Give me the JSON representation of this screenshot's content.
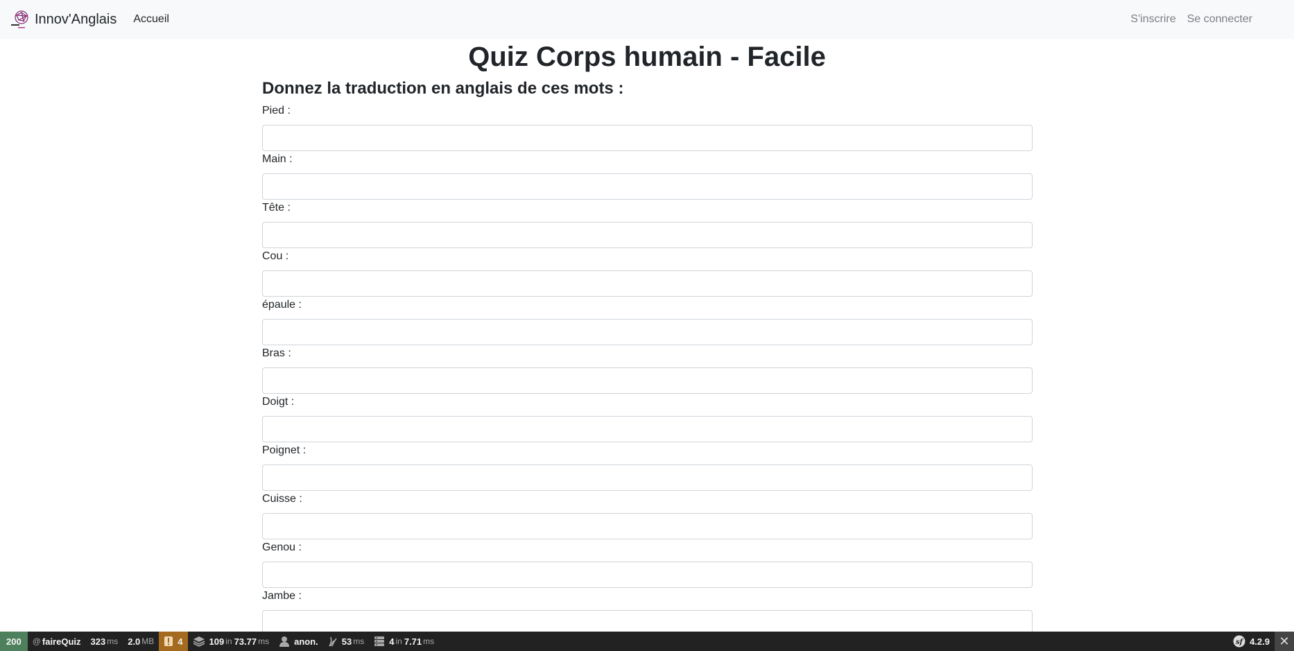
{
  "navbar": {
    "brand": "Innov'Anglais",
    "home": "Accueil",
    "signup": "S'inscrire",
    "login": "Se connecter"
  },
  "main": {
    "title": "Quiz Corps humain - Facile",
    "subtitle": "Donnez la traduction en anglais de ces mots :",
    "fields": [
      {
        "label": "Pied :",
        "value": ""
      },
      {
        "label": "Main :",
        "value": ""
      },
      {
        "label": "Tête :",
        "value": ""
      },
      {
        "label": "Cou :",
        "value": ""
      },
      {
        "label": "épaule :",
        "value": ""
      },
      {
        "label": "Bras :",
        "value": ""
      },
      {
        "label": "Doigt :",
        "value": ""
      },
      {
        "label": "Poignet :",
        "value": ""
      },
      {
        "label": "Cuisse :",
        "value": ""
      },
      {
        "label": "Genou :",
        "value": ""
      },
      {
        "label": "Jambe :",
        "value": ""
      }
    ]
  },
  "toolbar": {
    "status": "200",
    "route_prefix": "@",
    "route": "faireQuiz",
    "time_value": "323",
    "time_unit": "ms",
    "memory_value": "2.0",
    "memory_unit": "MB",
    "warnings": "4",
    "forms_value": "109",
    "forms_in": "in",
    "forms_time": "73.77",
    "forms_unit": "ms",
    "user": "anon.",
    "twig_value": "53",
    "twig_unit": "ms",
    "db_value": "4",
    "db_in": "in",
    "db_time": "7.71",
    "db_unit": "ms",
    "version": "4.2.9",
    "colors": {
      "status_ok": "#4f805d",
      "warning": "#a46a1f",
      "background": "#222222"
    }
  }
}
